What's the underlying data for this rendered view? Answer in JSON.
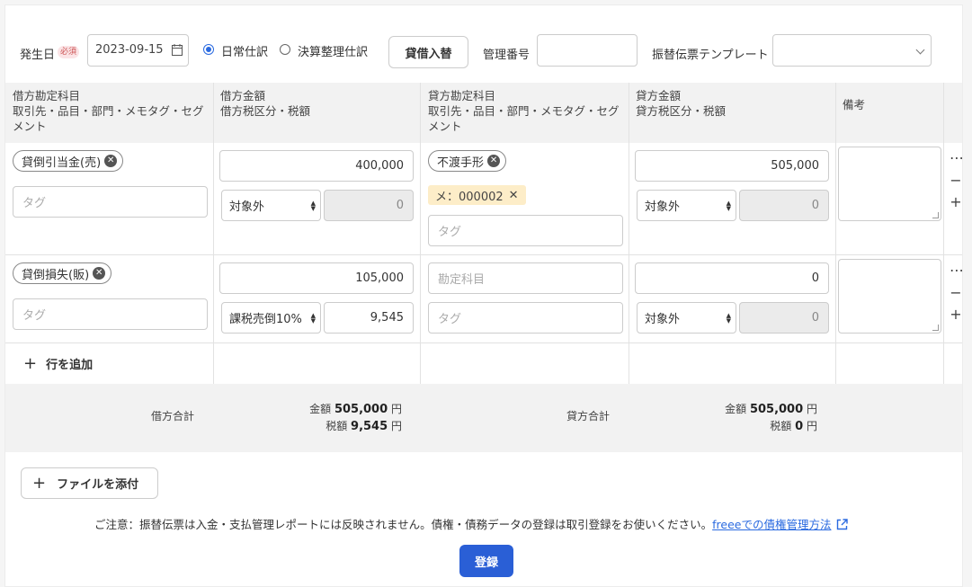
{
  "header": {
    "date_label": "発生日",
    "required_badge": "必須",
    "date_value": "2023-09-15",
    "radio_normal": "日常仕訳",
    "radio_closing": "決算整理仕訳",
    "swap_button": "貸借入替",
    "mgmt_number_label": "管理番号",
    "mgmt_number_value": "",
    "template_label": "振替伝票テンプレート",
    "template_value": ""
  },
  "columns": {
    "debit_account_l1": "借方勘定科目",
    "debit_account_l2": "取引先・品目・部門・メモタグ・セグメント",
    "debit_amount_l1": "借方金額",
    "debit_amount_l2": "借方税区分・税額",
    "credit_account_l1": "貸方勘定科目",
    "credit_account_l2": "取引先・品目・部門・メモタグ・セグメント",
    "credit_amount_l1": "貸方金額",
    "credit_amount_l2": "貸方税区分・税額",
    "remarks": "備考"
  },
  "rows": [
    {
      "debit_account": "貸倒引当金(売)",
      "debit_tag_placeholder": "タグ",
      "debit_amount": "400,000",
      "debit_tax_type": "対象外",
      "debit_tax": "0",
      "credit_account": "不渡手形",
      "credit_memo_tag": "メ：000002",
      "credit_tag_placeholder": "タグ",
      "credit_amount": "505,000",
      "credit_tax_type": "対象外",
      "credit_tax": "0"
    },
    {
      "debit_account": "貸倒損失(販)",
      "debit_tag_placeholder": "タグ",
      "debit_amount": "105,000",
      "debit_tax_type": "課税売倒10%",
      "debit_tax": "9,545",
      "credit_account_placeholder": "勘定科目",
      "credit_tag_placeholder": "タグ",
      "credit_amount": "0",
      "credit_tax_type": "対象外",
      "credit_tax": "0"
    }
  ],
  "add_row": "行を追加",
  "totals": {
    "debit_label": "借方合計",
    "debit_amount_label": "金額",
    "debit_amount": "505,000",
    "debit_tax_label": "税額",
    "debit_tax": "9,545",
    "credit_label": "貸方合計",
    "credit_amount_label": "金額",
    "credit_amount": "505,000",
    "credit_tax_label": "税額",
    "credit_tax": "0",
    "unit": "円"
  },
  "attach_file": "ファイルを添付",
  "notice_text": "ご注意：振替伝票は入金・支払管理レポートには反映されません。債権・債務データの登録は取引登録をお使いください。",
  "notice_link": "freeeでの債権管理方法",
  "submit": "登録",
  "colors": {
    "accent": "#2a5fd6",
    "memo_tag_bg": "#fdedc8"
  }
}
